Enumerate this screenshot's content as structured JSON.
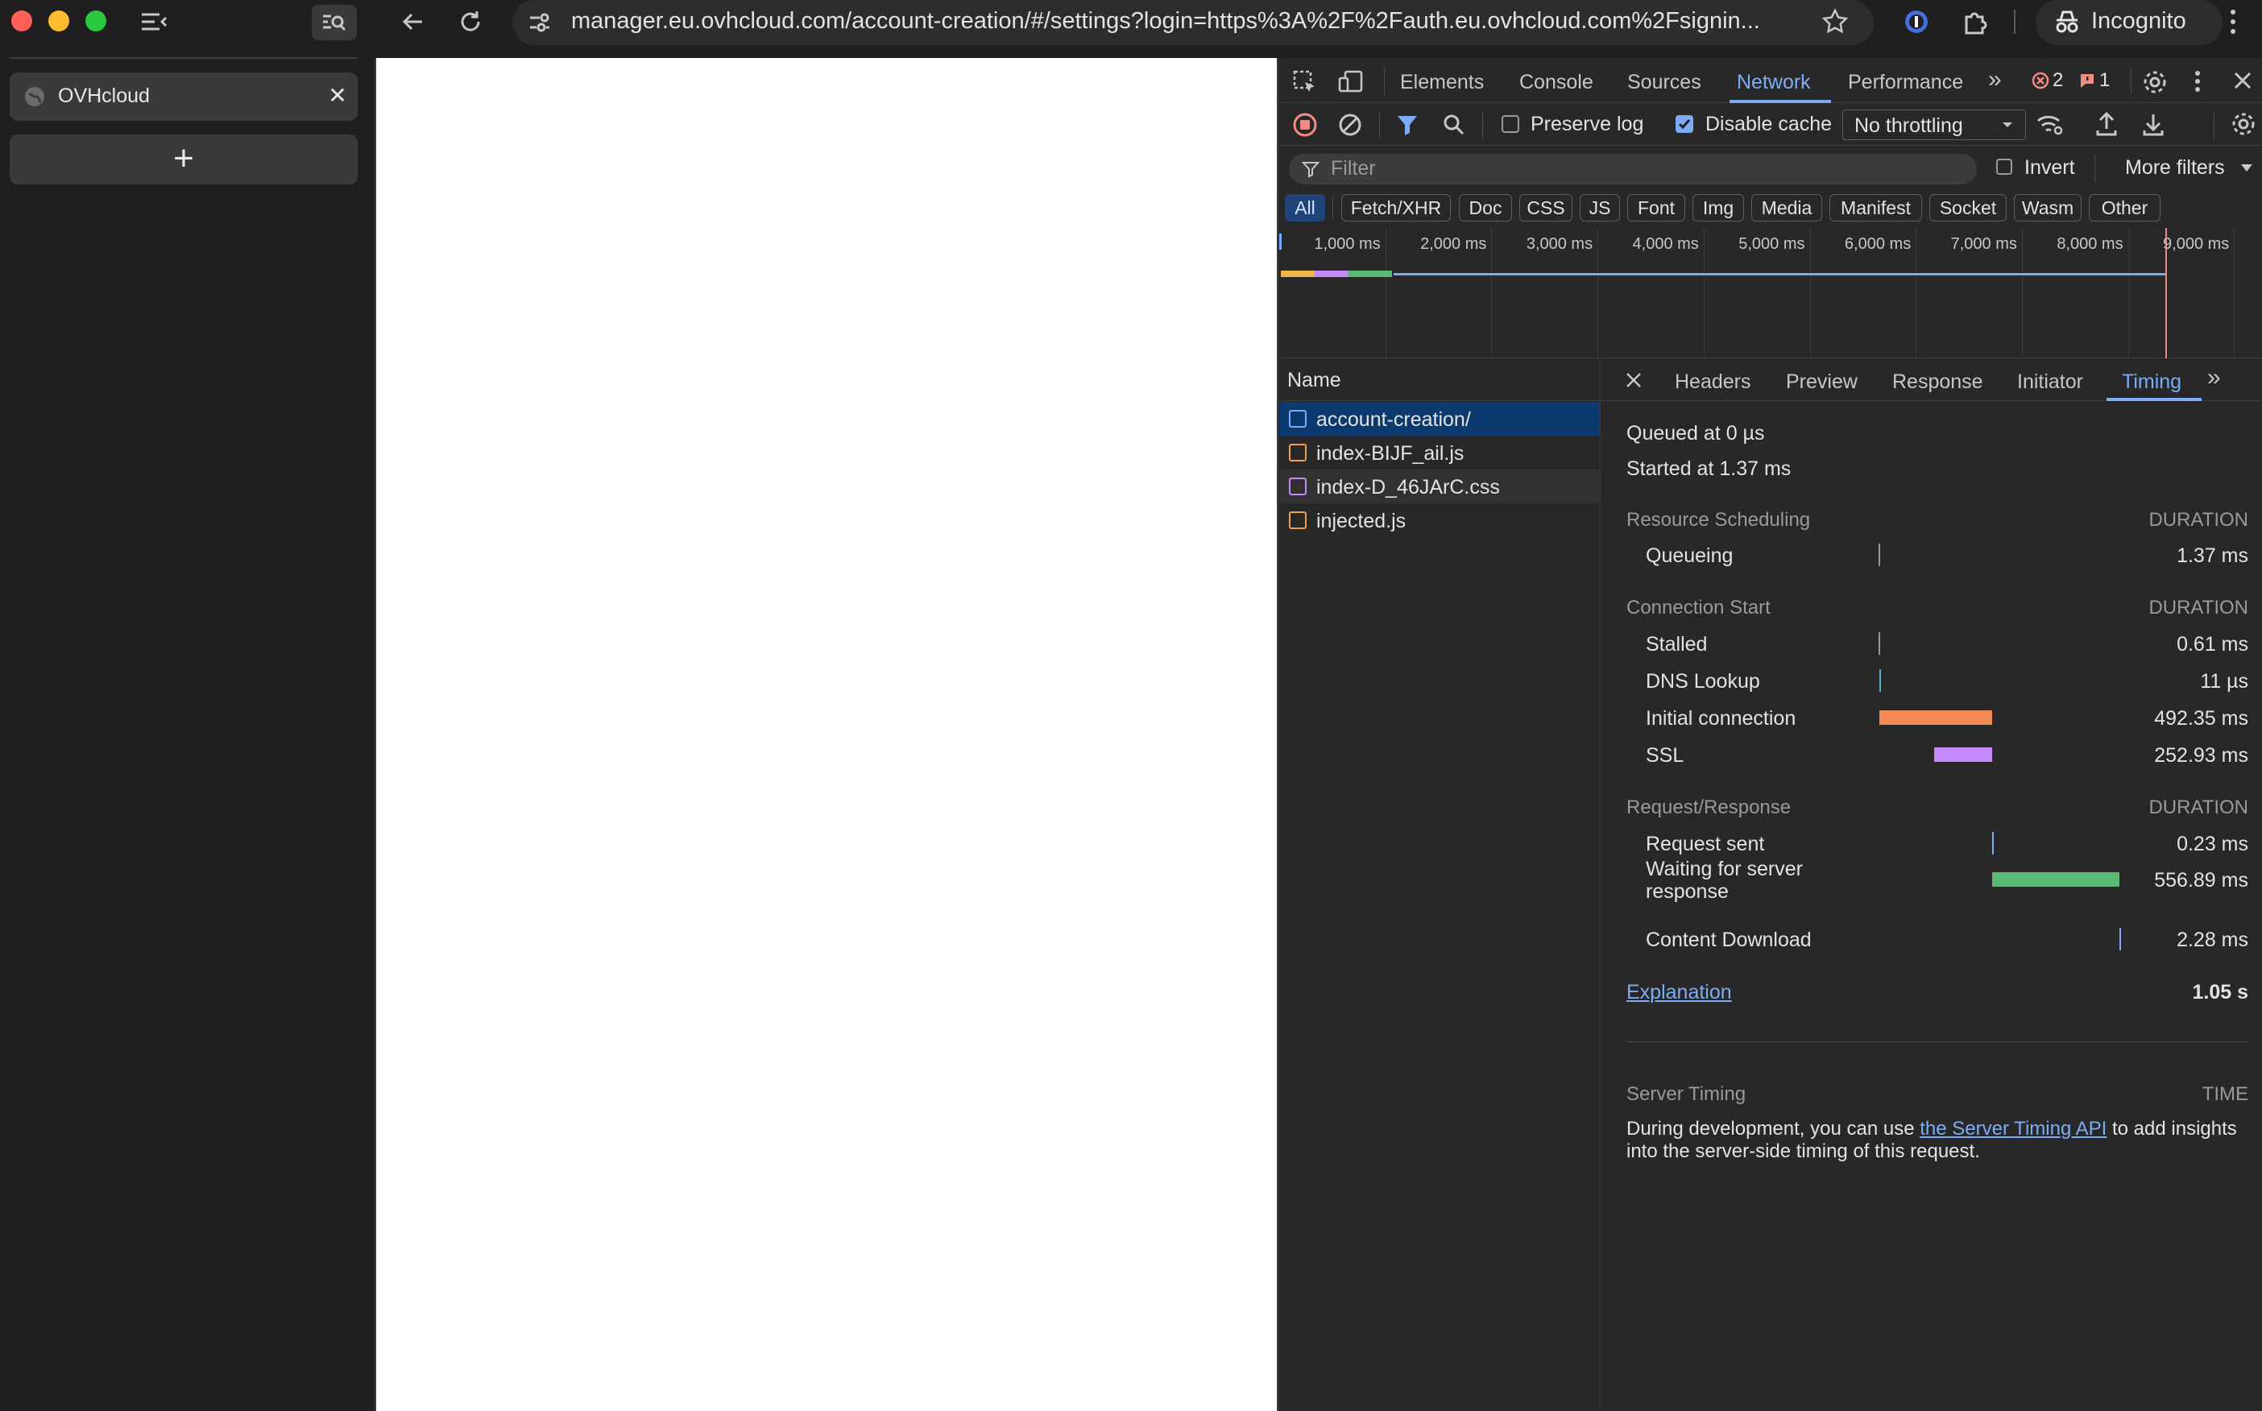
{
  "sidebar": {
    "tab_title": "OVHcloud",
    "tab_close": "✕",
    "new_tab": "+"
  },
  "topbar": {
    "url": "manager.eu.ovhcloud.com/account-creation/#/settings?login=https%3A%2F%2Fauth.eu.ovhcloud.com%2Fsignin...",
    "incognito": "Incognito"
  },
  "devtools": {
    "tabs": [
      "Elements",
      "Console",
      "Sources",
      "Network",
      "Performance"
    ],
    "active_tab": "Network",
    "errors_count": "2",
    "issues_count": "1",
    "toolbar": {
      "preserve_log": "Preserve log",
      "preserve_log_checked": false,
      "disable_cache": "Disable cache",
      "disable_cache_checked": true,
      "throttling": "No throttling"
    },
    "filter": {
      "placeholder": "Filter",
      "invert": "Invert",
      "more_filters": "More filters"
    },
    "type_chips": [
      "All",
      "Fetch/XHR",
      "Doc",
      "CSS",
      "JS",
      "Font",
      "Img",
      "Media",
      "Manifest",
      "Socket",
      "Wasm",
      "Other"
    ],
    "active_chip": "All",
    "overview_ticks": [
      "1,000 ms",
      "2,000 ms",
      "3,000 ms",
      "4,000 ms",
      "5,000 ms",
      "6,000 ms",
      "7,000 ms",
      "8,000 ms",
      "9,000 ms"
    ],
    "name_header": "Name",
    "requests": [
      {
        "name": "account-creation/",
        "type": "doc",
        "selected": true
      },
      {
        "name": "index-BIJF_ail.js",
        "type": "js",
        "selected": false
      },
      {
        "name": "index-D_46JArC.css",
        "type": "css",
        "selected": false
      },
      {
        "name": "injected.js",
        "type": "js",
        "selected": false
      }
    ],
    "detail_tabs": [
      "Headers",
      "Preview",
      "Response",
      "Initiator",
      "Timing"
    ],
    "active_detail_tab": "Timing",
    "timing": {
      "queued_at": "Queued at 0 µs",
      "started_at": "Started at 1.37 ms",
      "duration_label": "DURATION",
      "sections": [
        {
          "title": "Resource Scheduling",
          "rows": [
            {
              "label": "Queueing",
              "value": "1.37 ms",
              "start_ms": 0,
              "dur_ms": 1.37,
              "color": "#9a9a9a"
            }
          ]
        },
        {
          "title": "Connection Start",
          "rows": [
            {
              "label": "Stalled",
              "value": "0.61 ms",
              "start_ms": 1.37,
              "dur_ms": 0.61,
              "color": "#9a9a9a"
            },
            {
              "label": "DNS Lookup",
              "value": "11 µs",
              "start_ms": 1.98,
              "dur_ms": 0.011,
              "color": "#4fb3c6"
            },
            {
              "label": "Initial connection",
              "value": "492.35 ms",
              "start_ms": 1.99,
              "dur_ms": 492.35,
              "color": "#f28b54"
            },
            {
              "label": "SSL",
              "value": "252.93 ms",
              "start_ms": 241.41,
              "dur_ms": 252.93,
              "color": "#c58af9"
            }
          ]
        },
        {
          "title": "Request/Response",
          "rows": [
            {
              "label": "Request sent",
              "value": "0.23 ms",
              "start_ms": 494.34,
              "dur_ms": 0.23,
              "color": "#7cacf8"
            },
            {
              "label": "Waiting for server response",
              "value": "556.89 ms",
              "start_ms": 494.57,
              "dur_ms": 556.89,
              "color": "#5bb974"
            },
            {
              "label": "Content Download",
              "value": "2.28 ms",
              "start_ms": 1051.46,
              "dur_ms": 2.28,
              "color": "#7cacf8"
            }
          ]
        }
      ],
      "explanation": "Explanation",
      "total": "1.05 s",
      "total_ms": 1053.74,
      "server_timing_title": "Server Timing",
      "server_timing_time_label": "TIME",
      "server_timing_text_before": "During development, you can use ",
      "server_timing_link": "the Server Timing API",
      "server_timing_text_after": " to add insights into the server-side timing of this request."
    }
  }
}
